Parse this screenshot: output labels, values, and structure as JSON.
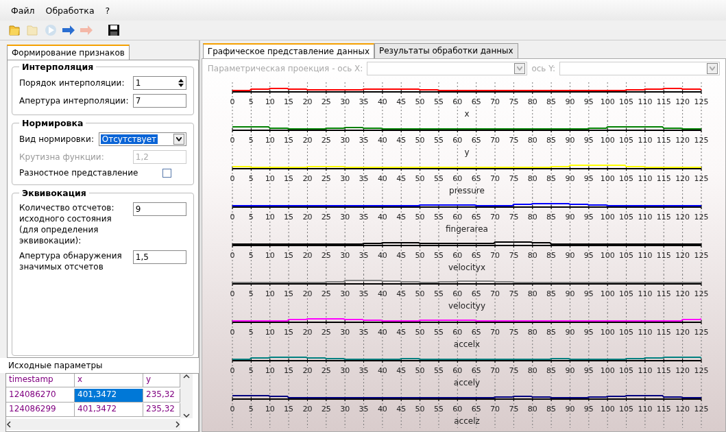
{
  "menu": [
    "Файл",
    "Обработка",
    "?"
  ],
  "left_tab": {
    "label": "Формирование признаков",
    "selected": true
  },
  "interpolation": {
    "title": "Интерполяция",
    "order_label": "Порядок интерполяции:",
    "order_value": "1",
    "aperture_label": "Апертура интерполяции:",
    "aperture_value": "7"
  },
  "normalization": {
    "title": "Нормировка",
    "type_label": "Вид нормировки:",
    "type_value": "Отсутствует",
    "slope_label": "Крутизна функции:",
    "slope_value": "1,2",
    "slope_disabled": true,
    "diff_label": "Разностное представление",
    "diff_checked": false
  },
  "equivocation": {
    "title": "Эквивокация",
    "count_label": "Количество отсчетов: исходного состояния (для определения эквивокации):",
    "count_value": "9",
    "aperture_label": "Апертура обнаружения значимых отсчетов",
    "aperture_value": "1,5"
  },
  "source_params": {
    "title": "Исходные параметры",
    "columns": [
      "timestamp",
      "x",
      "y"
    ],
    "rows": [
      {
        "cells": [
          {
            "text": "124086270",
            "selected": false
          },
          {
            "text": "401,3472",
            "selected": true
          },
          {
            "text": "235,32",
            "selected": false
          }
        ]
      },
      {
        "cells": [
          {
            "text": "124086299",
            "selected": false
          },
          {
            "text": "401,3472",
            "selected": false
          },
          {
            "text": "235,32",
            "selected": false
          }
        ]
      }
    ]
  },
  "right_tabs": [
    {
      "label": "Графическое представление данных",
      "selected": true
    },
    {
      "label": "Результаты обработки данных",
      "selected": false
    }
  ],
  "projection": {
    "label": "Параметрическая проекция  -  ось X:",
    "y_label": "ось Y:",
    "disabled": true
  },
  "plots": [
    {
      "name": "x",
      "color": "#ff0000",
      "xticks": [
        "0",
        "5",
        "10",
        "15",
        "20",
        "25",
        "30",
        "35",
        "40",
        "45",
        "50",
        "55",
        "60",
        "65",
        "70",
        "75",
        "80",
        "85",
        "90",
        "95",
        "100",
        "105",
        "110",
        "115",
        "120",
        "125"
      ]
    },
    {
      "name": "y",
      "color": "#008000",
      "xticks": [
        "0",
        "5",
        "10",
        "15",
        "20",
        "25",
        "30",
        "35",
        "40",
        "45",
        "50",
        "55",
        "60",
        "65",
        "70",
        "75",
        "80",
        "85",
        "90",
        "95",
        "100",
        "105",
        "110",
        "115",
        "120",
        "125"
      ]
    },
    {
      "name": "pressure",
      "color": "#ffff00",
      "xticks": [
        "0",
        "5",
        "10",
        "15",
        "20",
        "25",
        "30",
        "35",
        "40",
        "45",
        "50",
        "55",
        "60",
        "65",
        "70",
        "75",
        "80",
        "85",
        "90",
        "95",
        "100",
        "105",
        "110",
        "115",
        "120",
        "125"
      ]
    },
    {
      "name": "fingerarea",
      "color": "#0000ff",
      "xticks": [
        "0",
        "5",
        "10",
        "15",
        "20",
        "25",
        "30",
        "35",
        "40",
        "45",
        "50",
        "55",
        "60",
        "65",
        "70",
        "75",
        "80",
        "85",
        "90",
        "95",
        "100",
        "105",
        "110",
        "115",
        "120",
        "125"
      ]
    },
    {
      "name": "velocityx",
      "color": "#000000",
      "xticks": [
        "0",
        "5",
        "10",
        "15",
        "20",
        "25",
        "30",
        "35",
        "40",
        "45",
        "50",
        "55",
        "60",
        "65",
        "70",
        "75",
        "80",
        "85",
        "90",
        "95",
        "100",
        "105",
        "110",
        "115",
        "120",
        "125"
      ]
    },
    {
      "name": "velocityy",
      "color": "#808080",
      "xticks": [
        "0",
        "5",
        "10",
        "15",
        "20",
        "25",
        "30",
        "35",
        "40",
        "45",
        "50",
        "55",
        "60",
        "65",
        "70",
        "75",
        "80",
        "85",
        "90",
        "95",
        "100",
        "105",
        "110",
        "115",
        "120",
        "125"
      ]
    },
    {
      "name": "accelx",
      "color": "#ff00ff",
      "xticks": [
        "0",
        "5",
        "10",
        "15",
        "20",
        "25",
        "30",
        "35",
        "40",
        "45",
        "50",
        "55",
        "60",
        "65",
        "70",
        "75",
        "80",
        "85",
        "90",
        "95",
        "100",
        "105",
        "110",
        "115",
        "120",
        "125"
      ]
    },
    {
      "name": "accely",
      "color": "#008080",
      "xticks": [
        "0",
        "5",
        "10",
        "15",
        "20",
        "25",
        "30",
        "35",
        "40",
        "45",
        "50",
        "55",
        "60",
        "65",
        "70",
        "75",
        "80",
        "85",
        "90",
        "95",
        "100",
        "105",
        "110",
        "115",
        "120",
        "125"
      ]
    },
    {
      "name": "accelz",
      "color": "#000080",
      "xticks": [
        "0",
        "5",
        "10",
        "15",
        "20",
        "25",
        "30",
        "35",
        "40",
        "45",
        "50",
        "55",
        "60",
        "65",
        "70",
        "75",
        "80",
        "85",
        "90",
        "95",
        "100",
        "105",
        "110",
        "115",
        "120",
        "125"
      ]
    }
  ]
}
